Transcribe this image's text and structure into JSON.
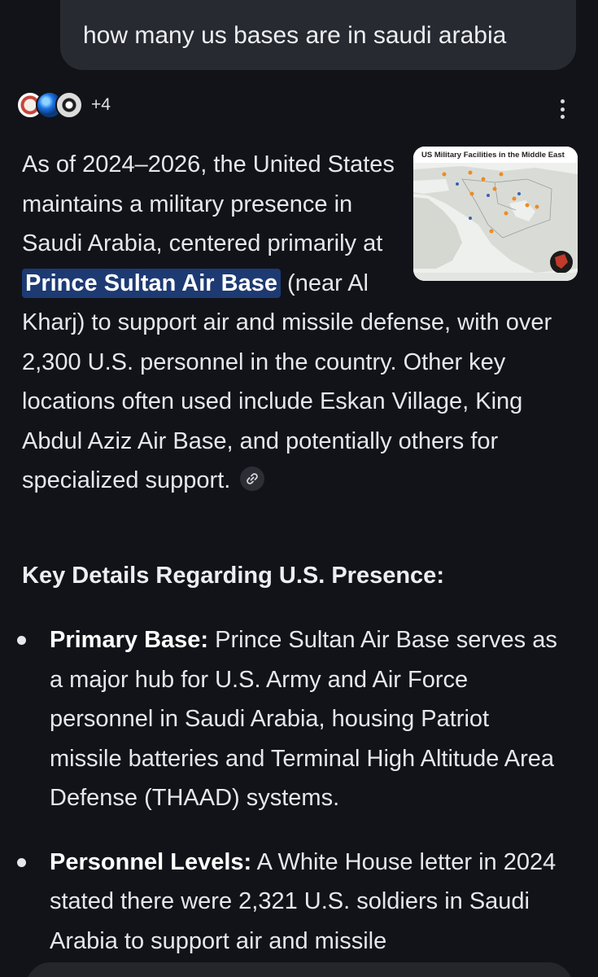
{
  "query": {
    "text": "how many us bases are in saudi arabia"
  },
  "sources": {
    "icons": [
      "source-badge-icon",
      "globe-icon",
      "soccer-ball-icon"
    ],
    "more_count": "+4"
  },
  "menu": {
    "icon": "more-vertical-icon"
  },
  "answer": {
    "part1": "As of 2024–2026, the United States maintains a military presence in Saudi Arabia, centered primarily at ",
    "highlight": "Prince Sultan Air Base",
    "part2": " (near Al Kharj) to support air and missile defense, with over 2,300 U.S. personnel in the country. Other key locations often used include Eskan Village, King Abdul Aziz Air Base, and potentially others for specialized support.",
    "link_icon": "link-icon"
  },
  "map_thumbnail": {
    "title": "US Military Facilities in the Middle East"
  },
  "section": {
    "heading": "Key Details Regarding U.S. Presence:"
  },
  "bullets": [
    {
      "label": "Primary Base:",
      "text": " Prince Sultan Air Base serves as a major hub for U.S. Army and Air Force personnel in Saudi Arabia, housing Patriot missile batteries and Terminal High Altitude Area Defense (THAAD) systems."
    },
    {
      "label": "Personnel Levels:",
      "text": " A White House letter in 2024 stated there were 2,321 U.S. soldiers in Saudi Arabia to support air and missile"
    }
  ],
  "colors": {
    "background": "#121318",
    "query_bubble": "#282a31",
    "highlight": "#1d3a73",
    "text": "#e6e7ec"
  }
}
